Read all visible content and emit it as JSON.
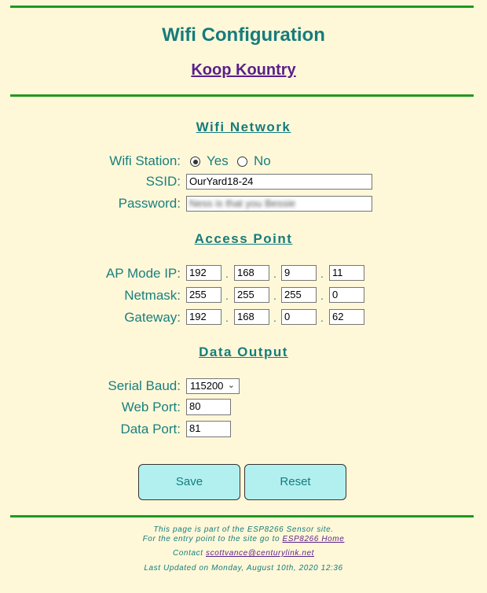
{
  "header": {
    "title": "Wifi Configuration",
    "site_link": "Koop Kountry"
  },
  "wifi": {
    "section_title": "Wifi Network",
    "station_label": "Wifi Station:",
    "yes_label": "Yes",
    "no_label": "No",
    "station_selected": "Yes",
    "ssid_label": "SSID:",
    "ssid_value": "OurYard18-24",
    "password_label": "Password:",
    "password_value": "Ness is that you Bessie"
  },
  "access_point": {
    "section_title": "Access Point",
    "ap_ip_label": "AP Mode IP:",
    "ap_ip": [
      "192",
      "168",
      "9",
      "11"
    ],
    "netmask_label": "Netmask:",
    "netmask": [
      "255",
      "255",
      "255",
      "0"
    ],
    "gateway_label": "Gateway:",
    "gateway": [
      "192",
      "168",
      "0",
      "62"
    ],
    "separator": "."
  },
  "data_output": {
    "section_title": "Data Output",
    "serial_baud_label": "Serial Baud:",
    "serial_baud_value": "115200",
    "web_port_label": "Web Port:",
    "web_port_value": "80",
    "data_port_label": "Data Port:",
    "data_port_value": "81"
  },
  "buttons": {
    "save": "Save",
    "reset": "Reset"
  },
  "footer": {
    "line1": "This page is part of the ESP8266 Sensor site.",
    "line2_prefix": "For the entry point to the site go to ",
    "line2_link": "ESP8266 Home",
    "contact_prefix": "Contact ",
    "contact_email": "scottvance@centurylink.net",
    "updated": "Last Updated on Monday, August 10th, 2020 12:36"
  },
  "colors": {
    "background": "#fff8d8",
    "accent": "#157c7c",
    "link": "#5a1f8c",
    "rule": "#1f9a1f",
    "button": "#b2f0f0"
  }
}
